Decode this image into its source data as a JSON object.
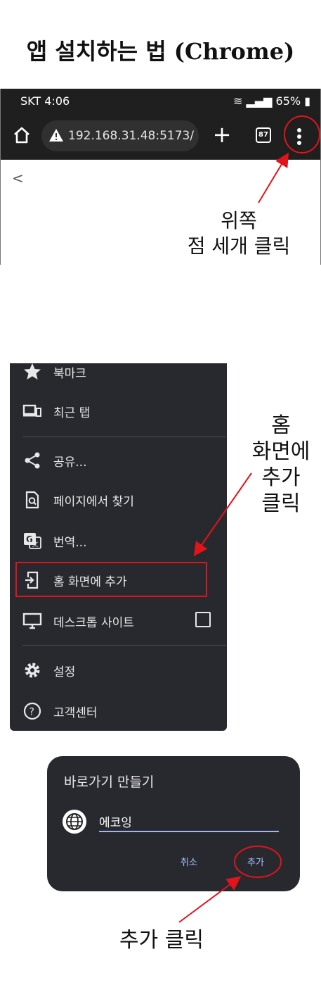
{
  "title": "앱 설치하는 법 (Chrome)",
  "screenshot1": {
    "status_left": "SKT 4:06",
    "status_battery": "65%",
    "url": "192.168.31.48:5173/",
    "tab_count": "87",
    "back_label": "<"
  },
  "annotation1": {
    "line1": "위쪽",
    "line2": "점 세개 클릭"
  },
  "menu": {
    "items": [
      {
        "label": "북마크",
        "icon": "star-icon"
      },
      {
        "label": "최근 탭",
        "icon": "devices-icon"
      },
      {
        "label": "공유...",
        "icon": "share-icon"
      },
      {
        "label": "페이지에서 찾기",
        "icon": "find-in-page-icon"
      },
      {
        "label": "번역...",
        "icon": "translate-icon"
      },
      {
        "label": "홈 화면에 추가",
        "icon": "add-to-home-icon"
      },
      {
        "label": "데스크톱 사이트",
        "icon": "desktop-icon"
      },
      {
        "label": "설정",
        "icon": "settings-gear-icon"
      },
      {
        "label": "고객센터",
        "icon": "help-icon"
      }
    ]
  },
  "annotation2": {
    "line1": "홈",
    "line2": "화면에",
    "line3": "추가",
    "line4": "클릭"
  },
  "dialog": {
    "title": "바로가기 만들기",
    "input_value": "에코잉",
    "cancel_label": "취소",
    "add_label": "추가"
  },
  "annotation3": {
    "text": "추가 클릭"
  },
  "colors": {
    "highlight_red": "#e0141a",
    "dark_bg": "#28292e",
    "accent_blue": "#a8c0ff"
  }
}
